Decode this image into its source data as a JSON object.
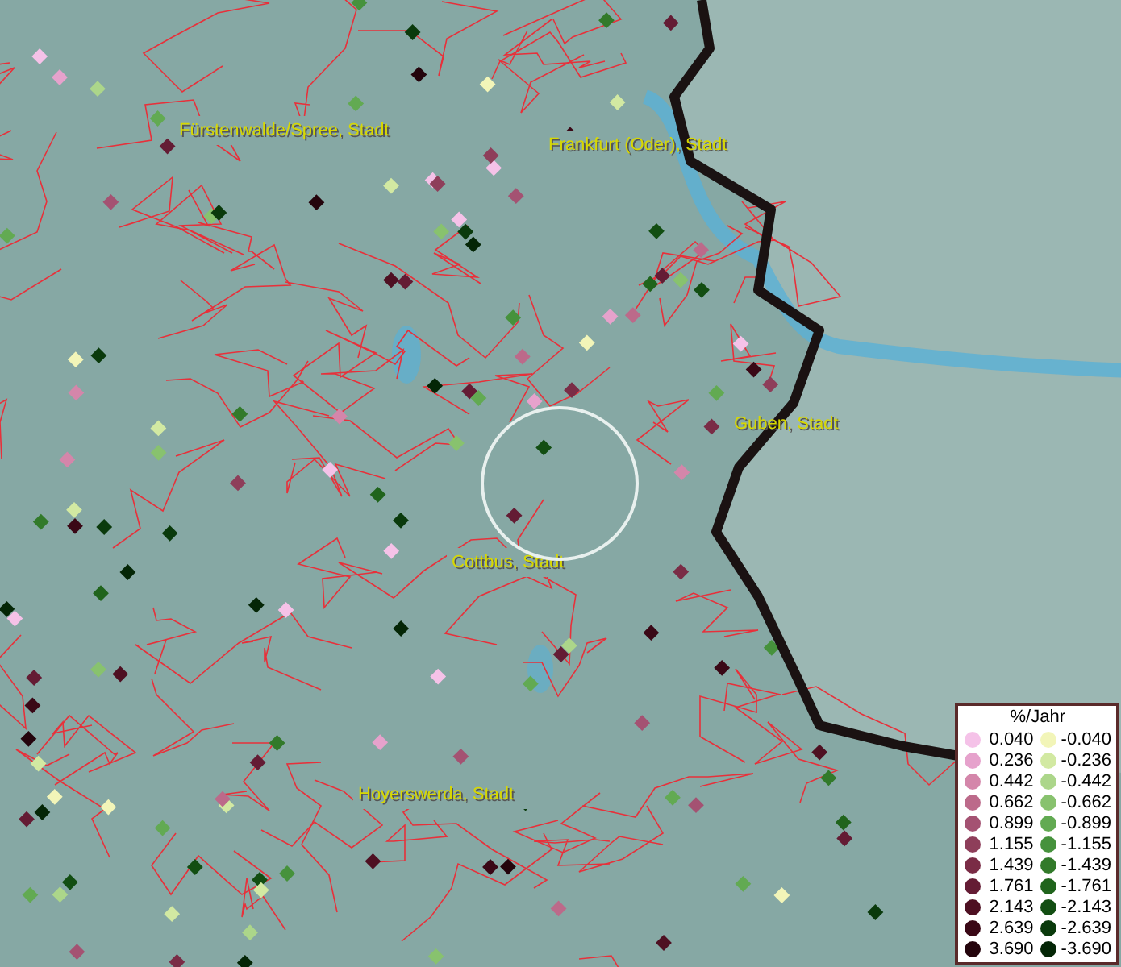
{
  "map": {
    "places": [
      {
        "name": "Fürstenwalde/Spree, Stadt"
      },
      {
        "name": "Frankfurt (Oder), Stadt"
      },
      {
        "name": "Guben, Stadt"
      },
      {
        "name": "Cottbus, Stadt"
      },
      {
        "name": "Hoyerswerda, Stadt"
      }
    ]
  },
  "legend": {
    "title": "%/Jahr",
    "entries": [
      {
        "label": "0.040",
        "color": "#f5c2e8"
      },
      {
        "label": "-0.040",
        "color": "#f2f5b8"
      },
      {
        "label": "0.236",
        "color": "#e6a2cc"
      },
      {
        "label": "-0.236",
        "color": "#d2e9a2"
      },
      {
        "label": "0.442",
        "color": "#d486aa"
      },
      {
        "label": "-0.442",
        "color": "#acd68a"
      },
      {
        "label": "0.662",
        "color": "#bc6a8a"
      },
      {
        "label": "-0.662",
        "color": "#88c26e"
      },
      {
        "label": "0.899",
        "color": "#a45272"
      },
      {
        "label": "-0.899",
        "color": "#62aa52"
      },
      {
        "label": "1.155",
        "color": "#8e3e5a"
      },
      {
        "label": "-1.155",
        "color": "#46923c"
      },
      {
        "label": "1.439",
        "color": "#7a2c46"
      },
      {
        "label": "-1.439",
        "color": "#327a2a"
      },
      {
        "label": "1.761",
        "color": "#641c34"
      },
      {
        "label": "-1.761",
        "color": "#20641c"
      },
      {
        "label": "2.143",
        "color": "#4e1022"
      },
      {
        "label": "-2.143",
        "color": "#124e12"
      },
      {
        "label": "2.639",
        "color": "#3a0816"
      },
      {
        "label": "-2.639",
        "color": "#0a3a0c"
      },
      {
        "label": "3.690",
        "color": "#24040c"
      },
      {
        "label": "-3.690",
        "color": "#042606"
      }
    ]
  }
}
